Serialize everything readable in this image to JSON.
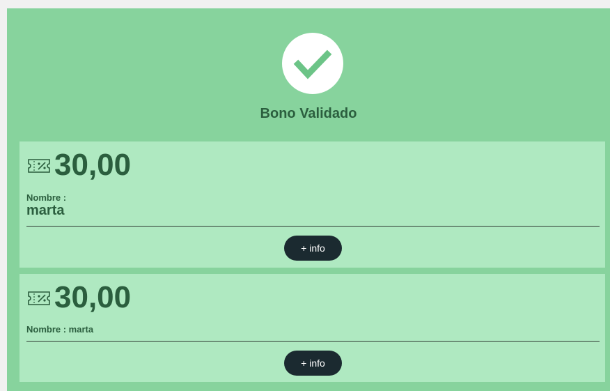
{
  "header": {
    "icon": "check-icon",
    "title": "Bono Validado"
  },
  "colors": {
    "panel_bg": "#87d39d",
    "card_bg": "#afe9c1",
    "text_dark_green": "#2b5e3e",
    "button_bg": "#1b2a30",
    "check_color": "#6cc487"
  },
  "vouchers": [
    {
      "icon": "ticket-percent-icon",
      "amount": "30,00",
      "name_label": "Nombre :",
      "name_value": "marta",
      "button_label": "+ info"
    },
    {
      "icon": "ticket-percent-icon",
      "amount": "30,00",
      "name_inline": "Nombre : marta",
      "button_label": "+ info"
    }
  ]
}
